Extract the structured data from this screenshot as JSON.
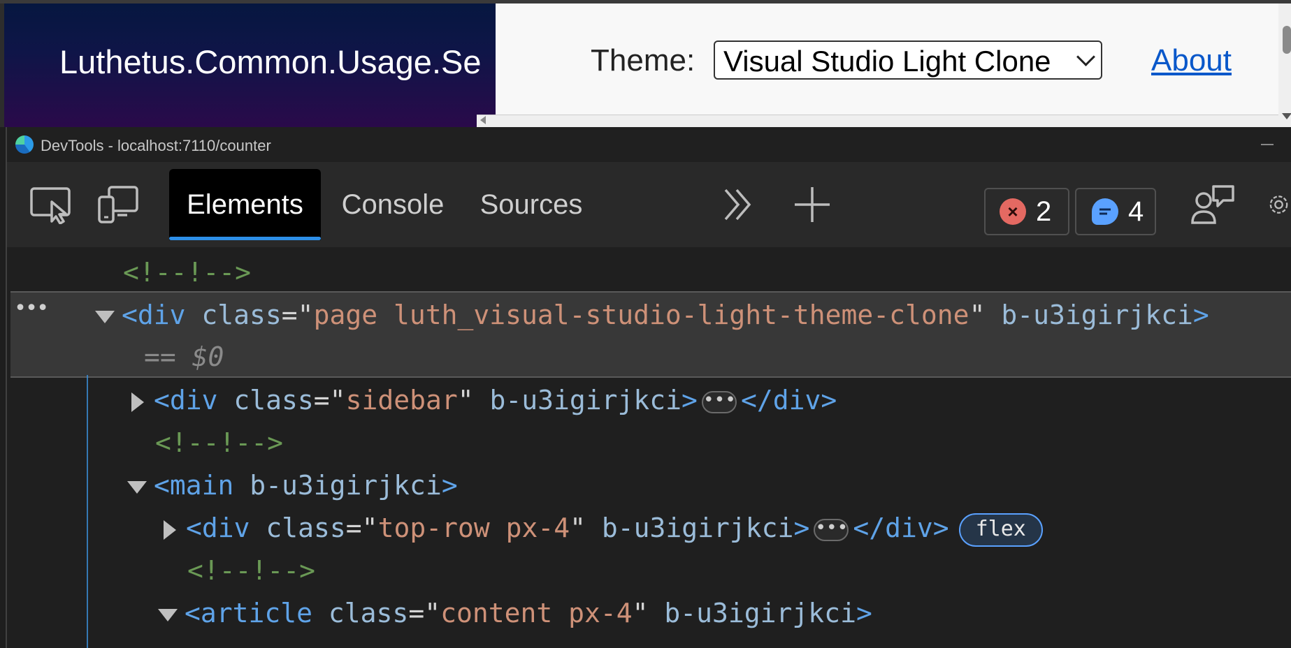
{
  "app": {
    "title": "Luthetus.Common.Usage.Se",
    "theme_label": "Theme:",
    "theme_value": "Visual Studio Light Clone",
    "about_link": "About"
  },
  "devtools": {
    "window_title": "DevTools - localhost:7110/counter",
    "tabs": [
      {
        "label": "Elements",
        "active": true
      },
      {
        "label": "Console",
        "active": false
      },
      {
        "label": "Sources",
        "active": false
      }
    ],
    "errors_count": "2",
    "messages_count": "4",
    "tree": {
      "comment": "<!--!-->",
      "div_open": "<div",
      "class_attr": "class",
      "eq": "=\"",
      "page_class": "page luth_visual-studio-light-theme-clone",
      "q_end": "\"",
      "scope_attr": "b-u3igirjkci",
      "selected_marker": "== $0",
      "sidebar_class": "sidebar",
      "close_div": "</div>",
      "gt": ">",
      "main_open": "<main",
      "top_row_class": "top-row px-4",
      "flex_badge": "flex",
      "article_open": "<article",
      "content_class": "content px-4"
    }
  },
  "icons": {
    "inspect": "inspect-element-icon",
    "device": "device-emulation-icon",
    "more_tabs": "chevron-double-right-icon",
    "add_tab": "plus-icon",
    "error": "error-x-icon",
    "message": "message-bubble-icon",
    "feedback": "feedback-icon",
    "settings": "gear-icon"
  }
}
